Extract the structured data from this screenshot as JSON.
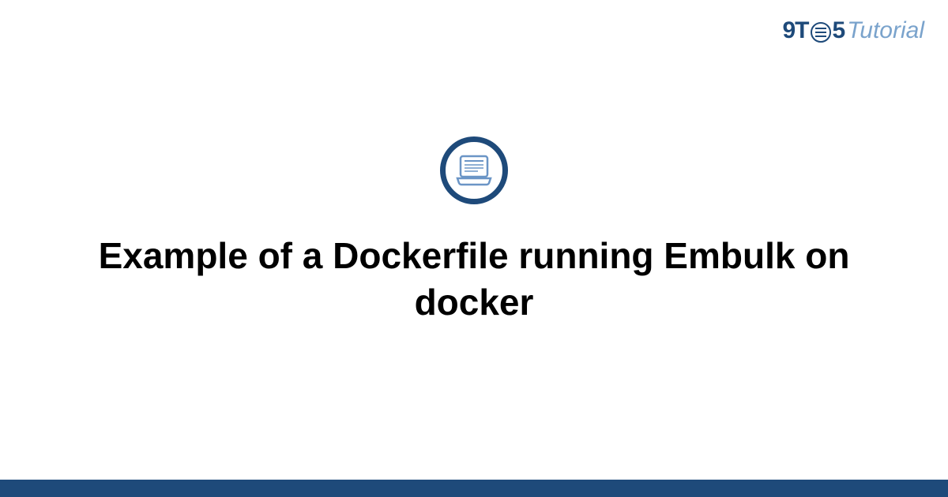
{
  "header": {
    "logo_part1": "9T",
    "logo_part2": "5",
    "logo_part3": "Tutorial"
  },
  "main": {
    "title": "Example of a Dockerfile running Embulk on docker"
  },
  "colors": {
    "brand_dark": "#1e4a7a",
    "brand_light": "#7aa3cc"
  }
}
